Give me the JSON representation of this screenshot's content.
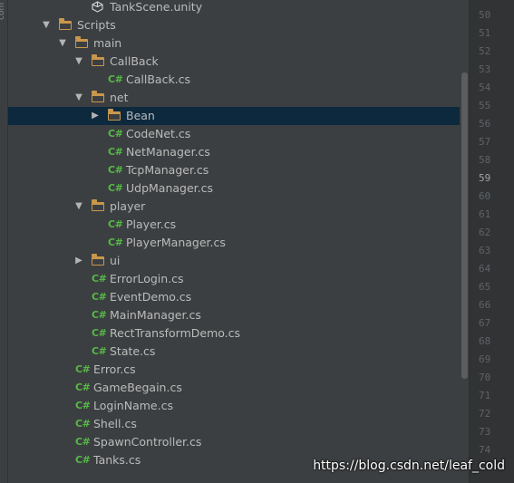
{
  "side_tab_label": "com",
  "tree": {
    "rows": [
      {
        "indent": 4,
        "arrow": "",
        "icon": "unity",
        "label": "TankScene.unity"
      },
      {
        "indent": 2,
        "arrow": "down",
        "icon": "folder",
        "label": "Scripts"
      },
      {
        "indent": 3,
        "arrow": "down",
        "icon": "folder",
        "label": "main"
      },
      {
        "indent": 4,
        "arrow": "down",
        "icon": "folder",
        "label": "CallBack"
      },
      {
        "indent": 5,
        "arrow": "",
        "icon": "cs",
        "label": "CallBack.cs"
      },
      {
        "indent": 4,
        "arrow": "down",
        "icon": "folder",
        "label": "net"
      },
      {
        "indent": 5,
        "arrow": "right",
        "icon": "folder",
        "label": "Bean",
        "selected": true
      },
      {
        "indent": 5,
        "arrow": "",
        "icon": "cs",
        "label": "CodeNet.cs"
      },
      {
        "indent": 5,
        "arrow": "",
        "icon": "cs",
        "label": "NetManager.cs"
      },
      {
        "indent": 5,
        "arrow": "",
        "icon": "cs",
        "label": "TcpManager.cs"
      },
      {
        "indent": 5,
        "arrow": "",
        "icon": "cs",
        "label": "UdpManager.cs"
      },
      {
        "indent": 4,
        "arrow": "down",
        "icon": "folder",
        "label": "player"
      },
      {
        "indent": 5,
        "arrow": "",
        "icon": "cs",
        "label": "Player.cs"
      },
      {
        "indent": 5,
        "arrow": "",
        "icon": "cs",
        "label": "PlayerManager.cs"
      },
      {
        "indent": 4,
        "arrow": "right",
        "icon": "folder",
        "label": "ui"
      },
      {
        "indent": 4,
        "arrow": "",
        "icon": "cs",
        "label": "ErrorLogin.cs"
      },
      {
        "indent": 4,
        "arrow": "",
        "icon": "cs",
        "label": "EventDemo.cs"
      },
      {
        "indent": 4,
        "arrow": "",
        "icon": "cs",
        "label": "MainManager.cs"
      },
      {
        "indent": 4,
        "arrow": "",
        "icon": "cs",
        "label": "RectTransformDemo.cs"
      },
      {
        "indent": 4,
        "arrow": "",
        "icon": "cs",
        "label": "State.cs"
      },
      {
        "indent": 3,
        "arrow": "",
        "icon": "cs",
        "label": "Error.cs"
      },
      {
        "indent": 3,
        "arrow": "",
        "icon": "cs",
        "label": "GameBegain.cs"
      },
      {
        "indent": 3,
        "arrow": "",
        "icon": "cs",
        "label": "LoginName.cs"
      },
      {
        "indent": 3,
        "arrow": "",
        "icon": "cs",
        "label": "Shell.cs"
      },
      {
        "indent": 3,
        "arrow": "",
        "icon": "cs",
        "label": "SpawnController.cs"
      },
      {
        "indent": 3,
        "arrow": "",
        "icon": "cs",
        "label": "Tanks.cs"
      }
    ]
  },
  "cs_badge": "C#",
  "gutter": {
    "line_numbers": [
      "50",
      "51",
      "52",
      "53",
      "54",
      "55",
      "56",
      "57",
      "58",
      "59",
      "60",
      "61",
      "62",
      "63",
      "64",
      "65",
      "66",
      "67",
      "68",
      "69",
      "70",
      "71",
      "72",
      "73",
      "74"
    ],
    "current_line": "59"
  },
  "colors": {
    "selection": "#0d293e",
    "folder": "#c9974c",
    "cs_icon": "#55b946",
    "panel_bg": "#3c3f41",
    "gutter_bg": "#313335"
  },
  "watermark": "https://blog.csdn.net/leaf_cold"
}
